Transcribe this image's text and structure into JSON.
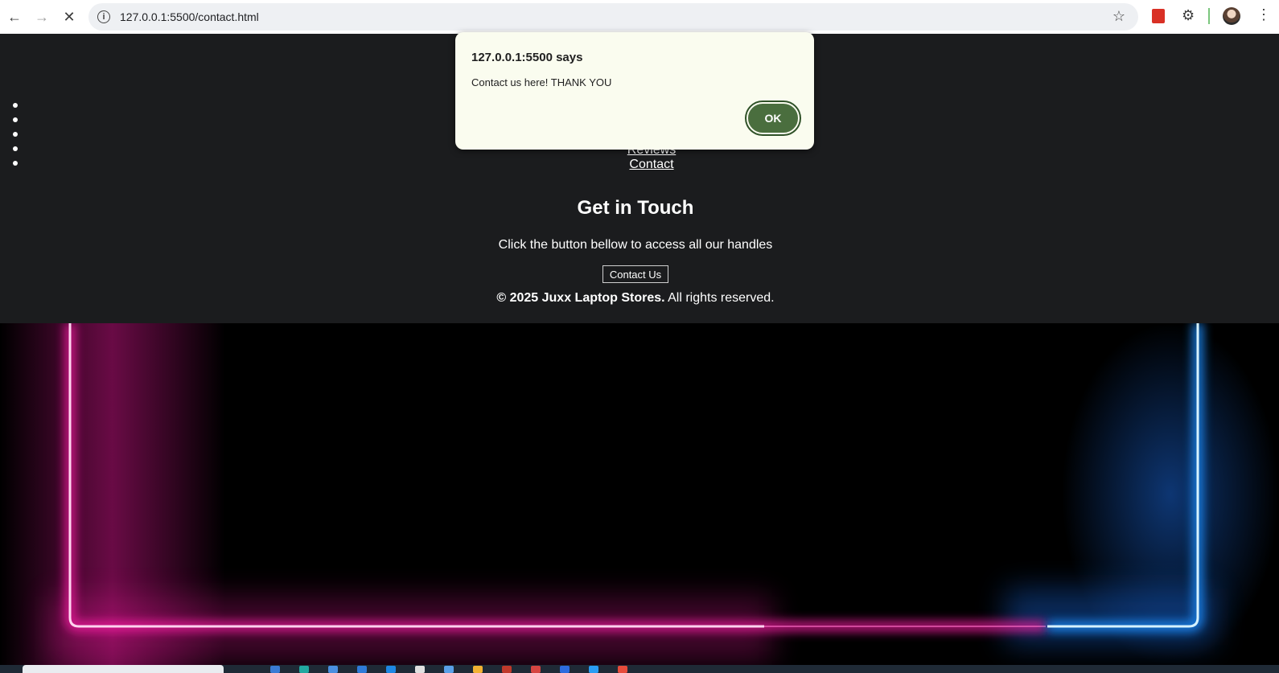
{
  "browser": {
    "url": "127.0.0.1:5500/contact.html",
    "back_icon": "arrow-left",
    "forward_icon": "arrow-right",
    "stop_icon": "close",
    "info_icon": "info",
    "star_icon": "star"
  },
  "nav": {
    "items": [
      "Reviews",
      "Contact"
    ]
  },
  "contact_section": {
    "title": "Get in Touch",
    "subtitle": "Click the button bellow to access all our handles",
    "button_label": "Contact Us"
  },
  "footer": {
    "copyright_bold": "© 2025 Juxx Laptop Stores.",
    "copyright_rest": " All rights reserved."
  },
  "alert": {
    "title": "127.0.0.1:5500 says",
    "message": "Contact us here! THANK YOU",
    "ok_label": "OK"
  },
  "colors": {
    "page_bg": "#1b1c1e",
    "neon_pink": "#ff1aa8",
    "neon_blue": "#1e90ff",
    "ok_button": "#4a6e3e"
  }
}
